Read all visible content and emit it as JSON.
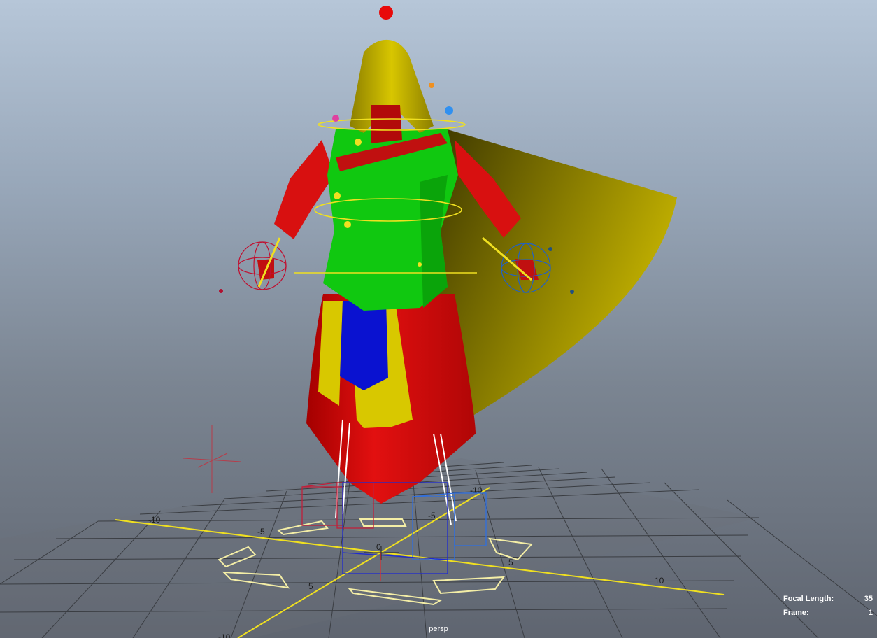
{
  "viewport": {
    "camera_name": "persp",
    "hud": {
      "focal_length_label": "Focal Length:",
      "focal_length_value": "35",
      "frame_label": "Frame:",
      "frame_value": "1"
    },
    "grid_labels": {
      "neg10_a": "-10",
      "neg5_a": "-5",
      "zero": "0",
      "five_a": "5",
      "ten_a": "10",
      "neg10_b": "-10",
      "neg5_b": "-5",
      "five_b": "5",
      "neg10_c": "-10"
    }
  },
  "colors": {
    "robe_red": "#e01010",
    "tunic_green": "#10c810",
    "hood_cape_yellow": "#d2c200",
    "sash_blue": "#0a12d0",
    "skirt_yellow": "#d8c800",
    "grid_axis_yellow": "#f0e020",
    "left_control_red": "#d8203a",
    "right_control_blue": "#3080e0"
  }
}
